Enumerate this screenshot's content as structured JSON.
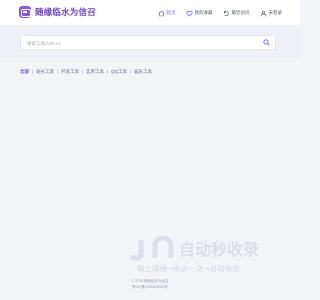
{
  "header": {
    "logo_text": "随缘临水为信召",
    "nav": [
      {
        "label": "首页",
        "icon": "home-icon",
        "active": true
      },
      {
        "label": "我的收藏",
        "icon": "heart-icon",
        "active": false
      },
      {
        "label": "最近访问",
        "icon": "recent-icon",
        "active": false
      },
      {
        "label": "未登录",
        "icon": "user-icon",
        "active": false
      }
    ]
  },
  "search": {
    "placeholder": "搜索工具(Ctrl+K)",
    "value": ""
  },
  "tabs": [
    {
      "label": "全部",
      "active": true
    },
    {
      "label": "站长工具",
      "active": false
    },
    {
      "label": "开发工具",
      "active": false
    },
    {
      "label": "实用工具",
      "active": false
    },
    {
      "label": "QQ工具",
      "active": false
    },
    {
      "label": "娱乐工具",
      "active": false
    }
  ],
  "watermark": {
    "title": "自动秒收录",
    "subtitle": "做上链接→来访一次→自动收录"
  },
  "footer": {
    "copyright": "© 2025 随缘临水为信召",
    "icp": "豫ICP备2025000000号"
  },
  "colors": {
    "accent": "#6c5ce7",
    "brand": "#8a57e6",
    "background": "#f3f4f8"
  }
}
